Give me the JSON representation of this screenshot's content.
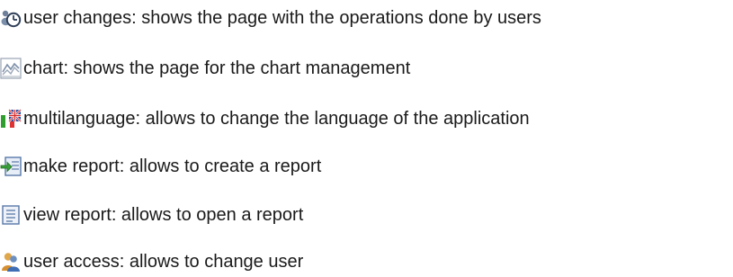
{
  "items": [
    {
      "icon": "user-changes-icon",
      "text": "user changes: shows the page with the operations done by users"
    },
    {
      "icon": "chart-icon",
      "text": "chart: shows the page for the chart management"
    },
    {
      "icon": "multilanguage-flag-icon",
      "text": "multilanguage: allows to change the language of the application"
    },
    {
      "icon": "make-report-icon",
      "text": "make report: allows to create a report"
    },
    {
      "icon": "view-report-icon",
      "text": "view report: allows to open a report"
    },
    {
      "icon": "user-access-icon",
      "text": "user access: allows to change user"
    }
  ]
}
